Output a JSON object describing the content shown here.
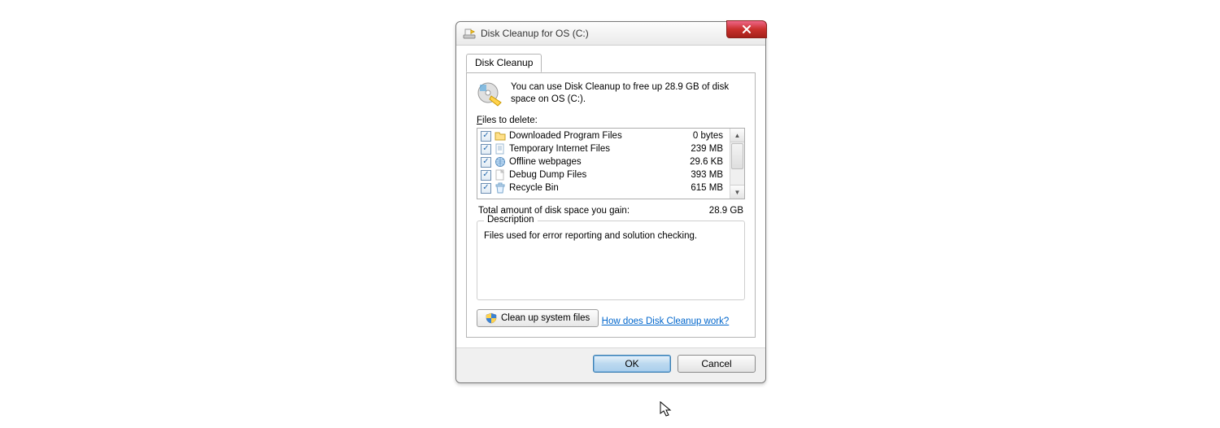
{
  "window": {
    "title": "Disk Cleanup for OS (C:)"
  },
  "tab": {
    "label": "Disk Cleanup"
  },
  "intro": {
    "text": "You can use Disk Cleanup to free up 28.9 GB of disk space on OS (C:)."
  },
  "files_label_prefix": "F",
  "files_label_rest": "iles to delete:",
  "files": [
    {
      "checked": true,
      "name": "Downloaded Program Files",
      "size": "0 bytes",
      "icon": "folder"
    },
    {
      "checked": true,
      "name": "Temporary Internet Files",
      "size": "239 MB",
      "icon": "doc"
    },
    {
      "checked": true,
      "name": "Offline webpages",
      "size": "29.6 KB",
      "icon": "globe"
    },
    {
      "checked": true,
      "name": "Debug Dump Files",
      "size": "393 MB",
      "icon": "file"
    },
    {
      "checked": true,
      "name": "Recycle Bin",
      "size": "615 MB",
      "icon": "recycle"
    }
  ],
  "total": {
    "label": "Total amount of disk space you gain:",
    "value": "28.9 GB"
  },
  "description": {
    "legend": "Description",
    "text": "Files used for error reporting and solution checking."
  },
  "cleanup_system_label": "Clean up system files",
  "help_link": "How does Disk Cleanup work?",
  "buttons": {
    "ok": "OK",
    "cancel": "Cancel"
  }
}
